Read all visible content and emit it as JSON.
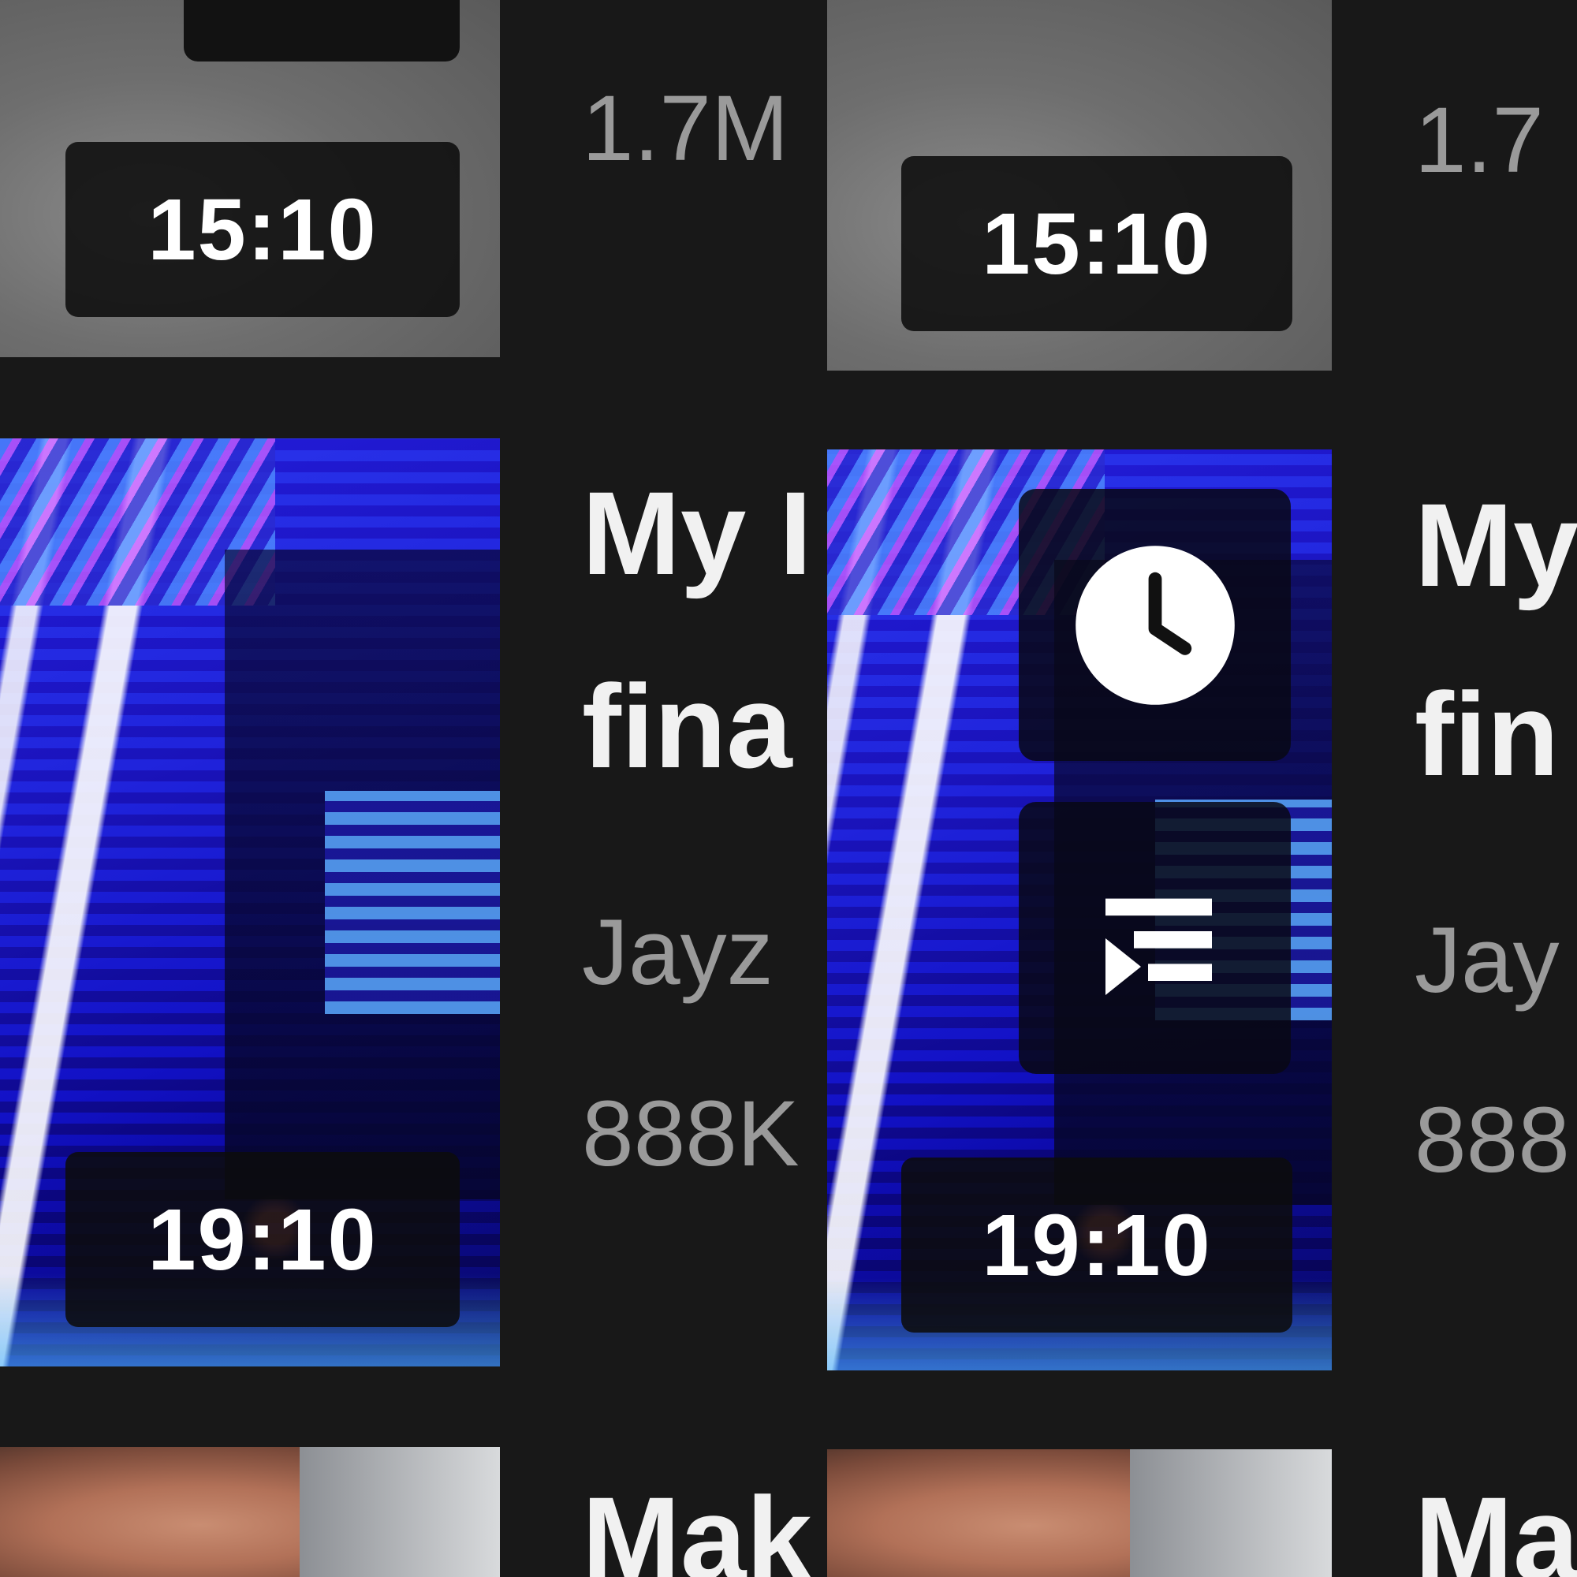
{
  "panels": {
    "left": {
      "items": [
        {
          "duration": "15:10",
          "views": "1.7M"
        },
        {
          "title_line1": "My I",
          "title_line2": "fina",
          "channel": "Jayz",
          "views": "888K",
          "duration": "19:10"
        },
        {
          "title_line1": "Mak"
        }
      ]
    },
    "right": {
      "items": [
        {
          "title_line1": "",
          "views": "1.7",
          "duration": "15:10"
        },
        {
          "title_line1": "My",
          "title_line2": "fin",
          "channel": "Jay",
          "views": "888",
          "duration": "19:10",
          "hover_actions": [
            {
              "icon": "clock-icon",
              "name": "watch-later"
            },
            {
              "icon": "add-to-queue-icon",
              "name": "add-to-queue"
            }
          ]
        },
        {
          "title_line1": "Ma"
        }
      ]
    }
  },
  "colors": {
    "background": "#181818",
    "title": "#f1f1f1",
    "meta": "#9a9a9a",
    "badge": "#0c0c0c"
  }
}
